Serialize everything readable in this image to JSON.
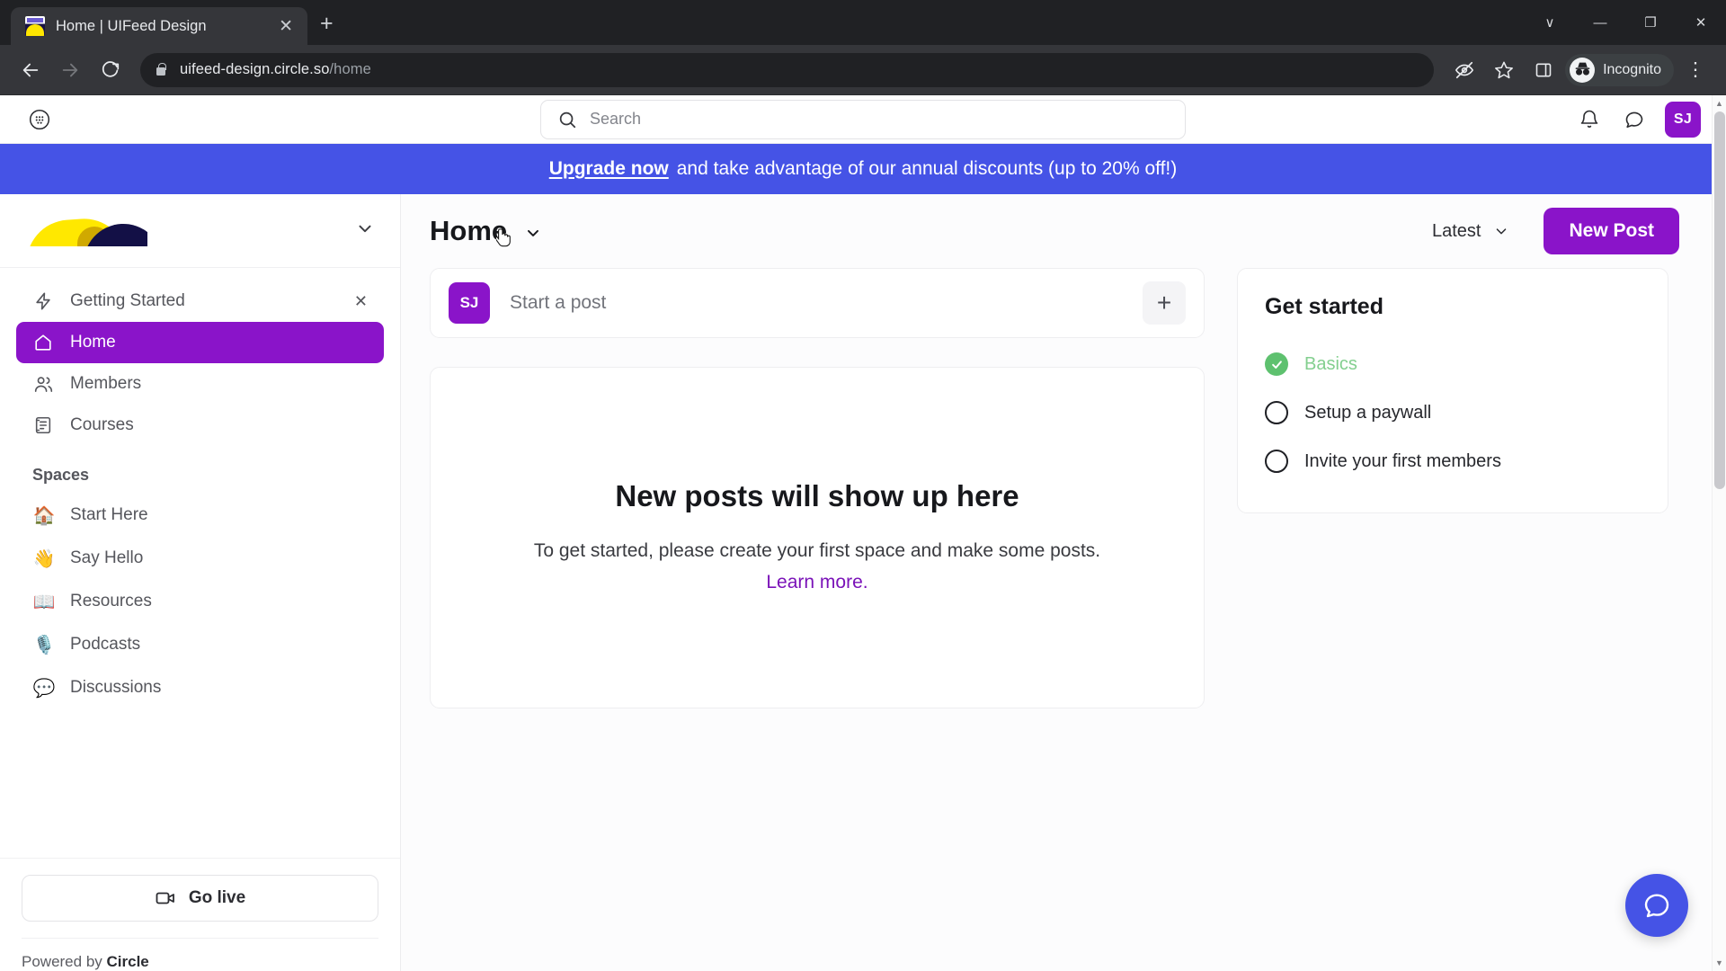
{
  "browser": {
    "tab": {
      "title": "Home | UIFeed Design",
      "favicon_name": "uifeed-favicon",
      "close_label": "✕"
    },
    "new_tab_label": "+",
    "window_controls": {
      "minimize_all": "∨",
      "minimize": "—",
      "restore": "❐",
      "close": "✕"
    },
    "nav": {
      "back": "←",
      "forward": "→",
      "reload": "↻"
    },
    "url": {
      "domain": "uifeed-design.circle.so",
      "path": "/home"
    },
    "profile_chip": "Incognito",
    "toolbar_icons": [
      "third-party-cookie-blocked-icon",
      "bookmark-star-icon",
      "side-panel-icon"
    ],
    "menu_label": "⋮"
  },
  "app_header": {
    "apps_icon": "apps-grid-icon",
    "search": {
      "placeholder": "Search"
    },
    "notifications_icon": "bell-icon",
    "messages_icon": "chat-bubble-icon",
    "avatar_initials": "SJ"
  },
  "banner": {
    "link_text": "Upgrade now",
    "rest_text": "and take advantage of our annual discounts (up to 20% off!)",
    "bg_color": "#4553e6"
  },
  "sidebar": {
    "logo_name": "uifeed-design-logo",
    "collapse_icon": "chevron-down-icon",
    "nav": [
      {
        "label": "Getting Started",
        "icon": "lightning-bolt-icon",
        "active": false,
        "dismissible": true,
        "dismiss_label": "✕"
      },
      {
        "label": "Home",
        "icon": "home-icon",
        "active": true,
        "dismissible": false
      },
      {
        "label": "Members",
        "icon": "members-icon",
        "active": false,
        "dismissible": false
      },
      {
        "label": "Courses",
        "icon": "courses-icon",
        "active": false,
        "dismissible": false
      }
    ],
    "spaces_label": "Spaces",
    "spaces": [
      {
        "label": "Start Here",
        "emoji": "🏠"
      },
      {
        "label": "Say Hello",
        "emoji": "👋"
      },
      {
        "label": "Resources",
        "emoji": "📖"
      },
      {
        "label": "Podcasts",
        "emoji": "🎙️"
      },
      {
        "label": "Discussions",
        "emoji": "💬"
      }
    ],
    "go_live_label": "Go live",
    "go_live_icon": "video-camera-icon",
    "powered_prefix": "Powered by",
    "powered_brand": "Circle",
    "active_color": "#8a14c9"
  },
  "main": {
    "page_title": "Home",
    "title_caret_icon": "chevron-down-icon",
    "sort": {
      "value": "Latest",
      "caret_icon": "chevron-down-icon"
    },
    "new_post_label": "New Post",
    "composer": {
      "avatar_initials": "SJ",
      "placeholder": "Start a post",
      "add_label": "+"
    },
    "empty_state": {
      "title": "New posts will show up here",
      "subtitle": "To get started, please create your first space and make some posts.",
      "link_text": "Learn more."
    }
  },
  "get_started": {
    "title": "Get started",
    "items": [
      {
        "label": "Basics",
        "done": true
      },
      {
        "label": "Setup a paywall",
        "done": false
      },
      {
        "label": "Invite your first members",
        "done": false
      }
    ],
    "done_color": "#5ec16f"
  },
  "chat_fab": {
    "icon": "chat-support-icon",
    "color": "#4553e6"
  }
}
